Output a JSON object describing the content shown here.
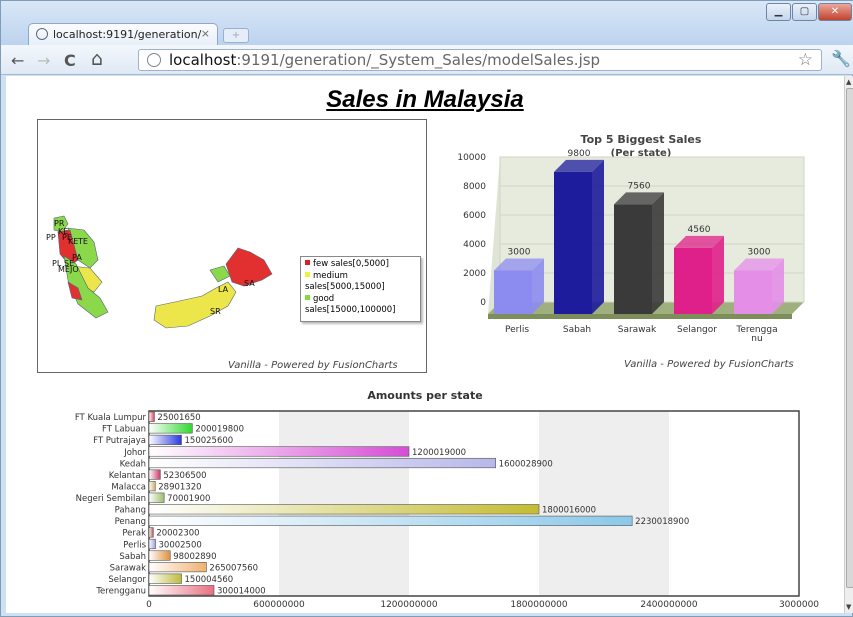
{
  "browser": {
    "tab_title": "localhost:9191/generation/",
    "tab_close": "×",
    "url_host": "localhost",
    "url_rest": ":9191/generation/_System_Sales/modelSales.jsp",
    "back": "←",
    "forward": "→",
    "reload": "C",
    "home": "⌂",
    "bookmark": "☆",
    "wrench": "🔧"
  },
  "page": {
    "title": "Sales in Malaysia"
  },
  "map": {
    "credit": "Vanilla - Powered by FusionCharts",
    "labels": [
      "PR",
      "KE",
      "PP",
      "PE",
      "KE",
      "TE",
      "PA",
      "PL",
      "SE",
      "ME",
      "JO",
      "LA",
      "SA",
      "SR"
    ],
    "legend": [
      {
        "label": "few sales[0,5000]",
        "color": "#e11e1e"
      },
      {
        "label": "medium sales[5000,15000]",
        "color": "#f5ef3c"
      },
      {
        "label": "good sales[15000,100000]",
        "color": "#7fdd3a"
      }
    ],
    "colors": {
      "few": "#e23030",
      "medium": "#ece64a",
      "good": "#8bd84a"
    }
  },
  "chart_data": [
    {
      "type": "bar",
      "title": "Top 5 Biggest Sales",
      "subtitle": "(Per state)",
      "categories": [
        "Perlis",
        "Sabah",
        "Sarawak",
        "Selangor",
        "Terengganu"
      ],
      "category_labels": [
        [
          "Perlis"
        ],
        [
          "Sabah"
        ],
        [
          "Sarawak"
        ],
        [
          "Selangor"
        ],
        [
          "Terengga",
          "nu"
        ]
      ],
      "values": [
        3000,
        9800,
        7560,
        4560,
        3000
      ],
      "colors": [
        "#8c8cf0",
        "#1c1c9c",
        "#3a3a3a",
        "#e0208a",
        "#e48ee8"
      ],
      "yticks": [
        0,
        2000,
        4000,
        6000,
        8000,
        10000
      ],
      "ylim": [
        0,
        10000
      ],
      "credit": "Vanilla - Powered by FusionCharts"
    },
    {
      "type": "bar",
      "orientation": "horizontal",
      "title": "Amounts per state",
      "categories": [
        "FT Kuala Lumpur",
        "FT Labuan",
        "FT Putrajaya",
        "Johor",
        "Kedah",
        "Kelantan",
        "Malacca",
        "Negeri Sembilan",
        "Pahang",
        "Penang",
        "Perak",
        "Perlis",
        "Sabah",
        "Sarawak",
        "Selangor",
        "Terengganu"
      ],
      "values": [
        25001650,
        200019800,
        150025600,
        1200019000,
        1600028900,
        52306500,
        28901320,
        70001900,
        1800016000,
        2230018900,
        20002300,
        30002500,
        98002890,
        265007560,
        150004560,
        300014000
      ],
      "colors": [
        "#e23b5a",
        "#2fd82f",
        "#2a38e0",
        "#d64cd6",
        "#b8b8ea",
        "#c83c6a",
        "#ceb060",
        "#9bbd6a",
        "#c3bc33",
        "#8cc8e8",
        "#b05050",
        "#a0a0e0",
        "#e09040",
        "#f0b070",
        "#bcbc3c",
        "#e87080"
      ],
      "xticks": [
        "0",
        "600000000",
        "1200000000",
        "1800000000",
        "2400000000",
        "3000000"
      ],
      "xlim": [
        0,
        3000000000
      ]
    }
  ]
}
